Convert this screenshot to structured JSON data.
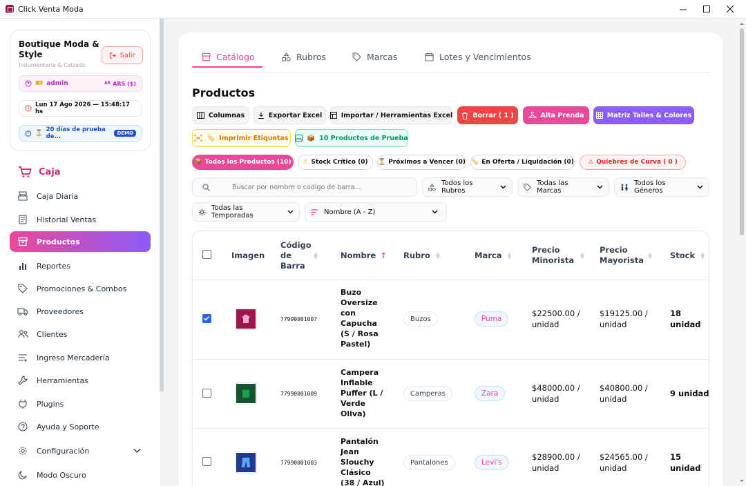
{
  "window": {
    "title": "Click Venta Moda"
  },
  "store": {
    "name": "Boutique Moda & Style",
    "subtitle": "Indumentaria & Calzado",
    "logout_label": "Salir",
    "user_label": "admin",
    "user_emoji": "🎫",
    "currency": "ARS ($)",
    "currency_flag": "AR",
    "datetime": "Lun 17 Ago 2026 — 15:48:17 hs",
    "trial_label": "20 días de prueba de...",
    "trial_emoji": "⏳",
    "demo_badge": "DEMO"
  },
  "sidebar": {
    "section": "Caja",
    "items": [
      {
        "label": "Caja Diaria",
        "icon": "cash-register-icon"
      },
      {
        "label": "Historial Ventas",
        "icon": "history-icon"
      },
      {
        "label": "Productos",
        "icon": "box-icon",
        "active": true
      },
      {
        "label": "Reportes",
        "icon": "bar-chart-icon"
      },
      {
        "label": "Promociones & Combos",
        "icon": "tag-icon"
      },
      {
        "label": "Proveedores",
        "icon": "truck-icon"
      },
      {
        "label": "Clientes",
        "icon": "users-icon"
      },
      {
        "label": "Ingreso Mercadería",
        "icon": "list-icon"
      },
      {
        "label": "Herramientas",
        "icon": "wrench-icon"
      },
      {
        "label": "Plugins",
        "icon": "plug-icon"
      },
      {
        "label": "Ayuda y Soporte",
        "icon": "help-icon"
      },
      {
        "label": "Configuración",
        "icon": "gear-icon"
      },
      {
        "label": "Modo Oscuro",
        "icon": "moon-icon"
      }
    ]
  },
  "tabs": [
    {
      "label": "Catálogo",
      "active": true
    },
    {
      "label": "Rubros"
    },
    {
      "label": "Marcas"
    },
    {
      "label": "Lotes y Vencimientos"
    }
  ],
  "section_title": "Productos",
  "toolbar": {
    "columns": "Columnas",
    "export": "Exportar Excel",
    "import": "Importar / Herramientas Excel",
    "delete": "Borrar ( 1 )",
    "new_item": "Alta Prenda",
    "matrix": "Matriz Talles & Colores",
    "print_labels": "Imprimir Etiquetas",
    "sample_products": "10 Productos de Prueba",
    "print_emoji": "🏷️",
    "sample_emoji": "📦"
  },
  "chips": [
    {
      "label": "Todos los Productos (10)",
      "emoji": "📦"
    },
    {
      "label": "Stock Crítico (0)",
      "emoji": "⚠"
    },
    {
      "label": "Próximos a Vencer (0)",
      "emoji": "⏳"
    },
    {
      "label": "En Oferta / Liquidación (0)",
      "emoji": "🏷️"
    },
    {
      "label": "Quiebres de Curva ( 0 )",
      "emoji": "⚠"
    }
  ],
  "filters": {
    "search_placeholder": "Buscar por nombre o código de barra...",
    "rubros": "Todos los Rubros",
    "marcas": "Todas las Marcas",
    "generos": "Todos los Géneros",
    "temporadas": "Todas las Temporadas",
    "sort": "Nombre (A - Z)"
  },
  "table": {
    "headers": {
      "image": "Imagen",
      "code": "Código de Barra",
      "name": "Nombre",
      "rubro": "Rubro",
      "marca": "Marca",
      "retail": "Precio Minorista",
      "wholesale": "Precio Mayorista",
      "stock": "Stock"
    },
    "rows": [
      {
        "checked": true,
        "code": "77990001007",
        "name": "Buzo Oversize con Capucha (S / Rosa Pastel)",
        "rubro": "Buzos",
        "marca": "Puma",
        "retail": "$22500.00 / unidad",
        "wholesale": "$19125.00 / unidad",
        "stock": "18 unidad",
        "img_color": "#9d174d",
        "img_icon": "hoodie-icon"
      },
      {
        "checked": false,
        "code": "77990001009",
        "name": "Campera Inflable Puffer (L / Verde Oliva)",
        "rubro": "Camperas",
        "marca": "Zara",
        "retail": "$48000.00 / unidad",
        "wholesale": "$40800.00 / unidad",
        "stock": "9 unidad",
        "img_color": "#14532d",
        "img_icon": "jacket-icon"
      },
      {
        "checked": false,
        "code": "77990001003",
        "name": "Pantalón Jean Slouchy Clásico (38 / Azul)",
        "rubro": "Pantalones",
        "marca": "Levi's",
        "retail": "$28900.00 / unidad",
        "wholesale": "$24565.00 / unidad",
        "stock": "15 unidad",
        "img_color": "#1e3a8a",
        "img_icon": "jeans-icon"
      }
    ]
  }
}
